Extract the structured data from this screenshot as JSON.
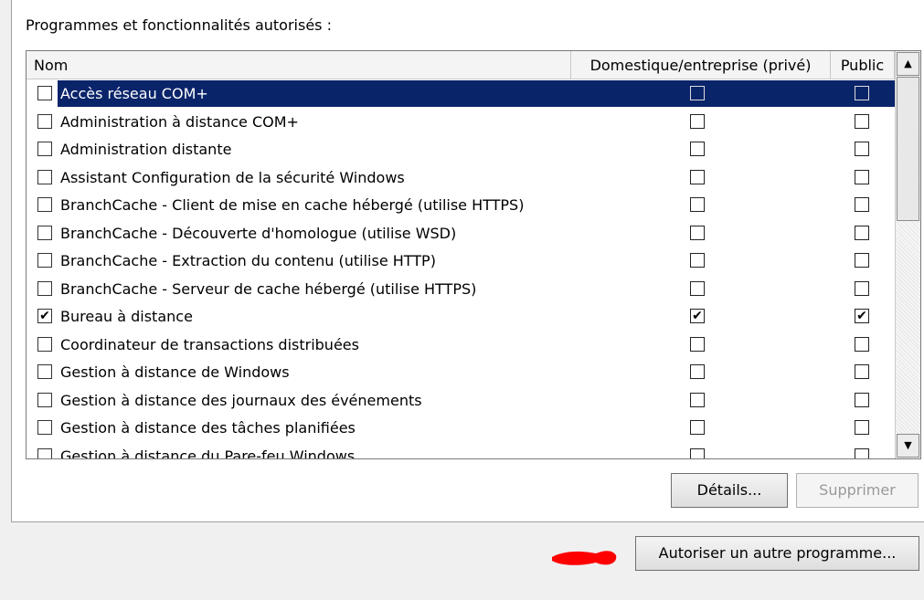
{
  "caption": "Programmes et fonctionnalités autorisés :",
  "columns": {
    "name": "Nom",
    "domestic": "Domestique/entreprise (privé)",
    "public": "Public"
  },
  "rows": [
    {
      "label": "Accès réseau COM+",
      "enabled": false,
      "domestic": false,
      "public": false,
      "selected": true
    },
    {
      "label": "Administration à distance COM+",
      "enabled": false,
      "domestic": false,
      "public": false
    },
    {
      "label": "Administration distante",
      "enabled": false,
      "domestic": false,
      "public": false
    },
    {
      "label": "Assistant Configuration de la sécurité Windows",
      "enabled": false,
      "domestic": false,
      "public": false
    },
    {
      "label": "BranchCache - Client de mise en cache hébergé (utilise HTTPS)",
      "enabled": false,
      "domestic": false,
      "public": false
    },
    {
      "label": "BranchCache - Découverte d'homologue (utilise WSD)",
      "enabled": false,
      "domestic": false,
      "public": false
    },
    {
      "label": "BranchCache - Extraction du contenu (utilise HTTP)",
      "enabled": false,
      "domestic": false,
      "public": false
    },
    {
      "label": "BranchCache - Serveur de cache hébergé (utilise HTTPS)",
      "enabled": false,
      "domestic": false,
      "public": false
    },
    {
      "label": "Bureau à distance",
      "enabled": true,
      "domestic": true,
      "public": true
    },
    {
      "label": "Coordinateur de transactions distribuées",
      "enabled": false,
      "domestic": false,
      "public": false
    },
    {
      "label": "Gestion à distance de Windows",
      "enabled": false,
      "domestic": false,
      "public": false
    },
    {
      "label": "Gestion à distance des journaux des événements",
      "enabled": false,
      "domestic": false,
      "public": false
    },
    {
      "label": "Gestion à distance des tâches planifiées",
      "enabled": false,
      "domestic": false,
      "public": false
    },
    {
      "label": "Gestion à distance du Pare-feu Windows",
      "enabled": false,
      "domestic": false,
      "public": false
    }
  ],
  "buttons": {
    "details": "Détails...",
    "remove": "Supprimer",
    "allow_other": "Autoriser un autre programme..."
  },
  "icons": {
    "scroll_up": "scroll-up-arrow-icon",
    "scroll_down": "scroll-down-arrow-icon",
    "annotation": "red-arrow-mark"
  },
  "colors": {
    "selection": "#0a246a",
    "annotation": "#ff0000"
  }
}
